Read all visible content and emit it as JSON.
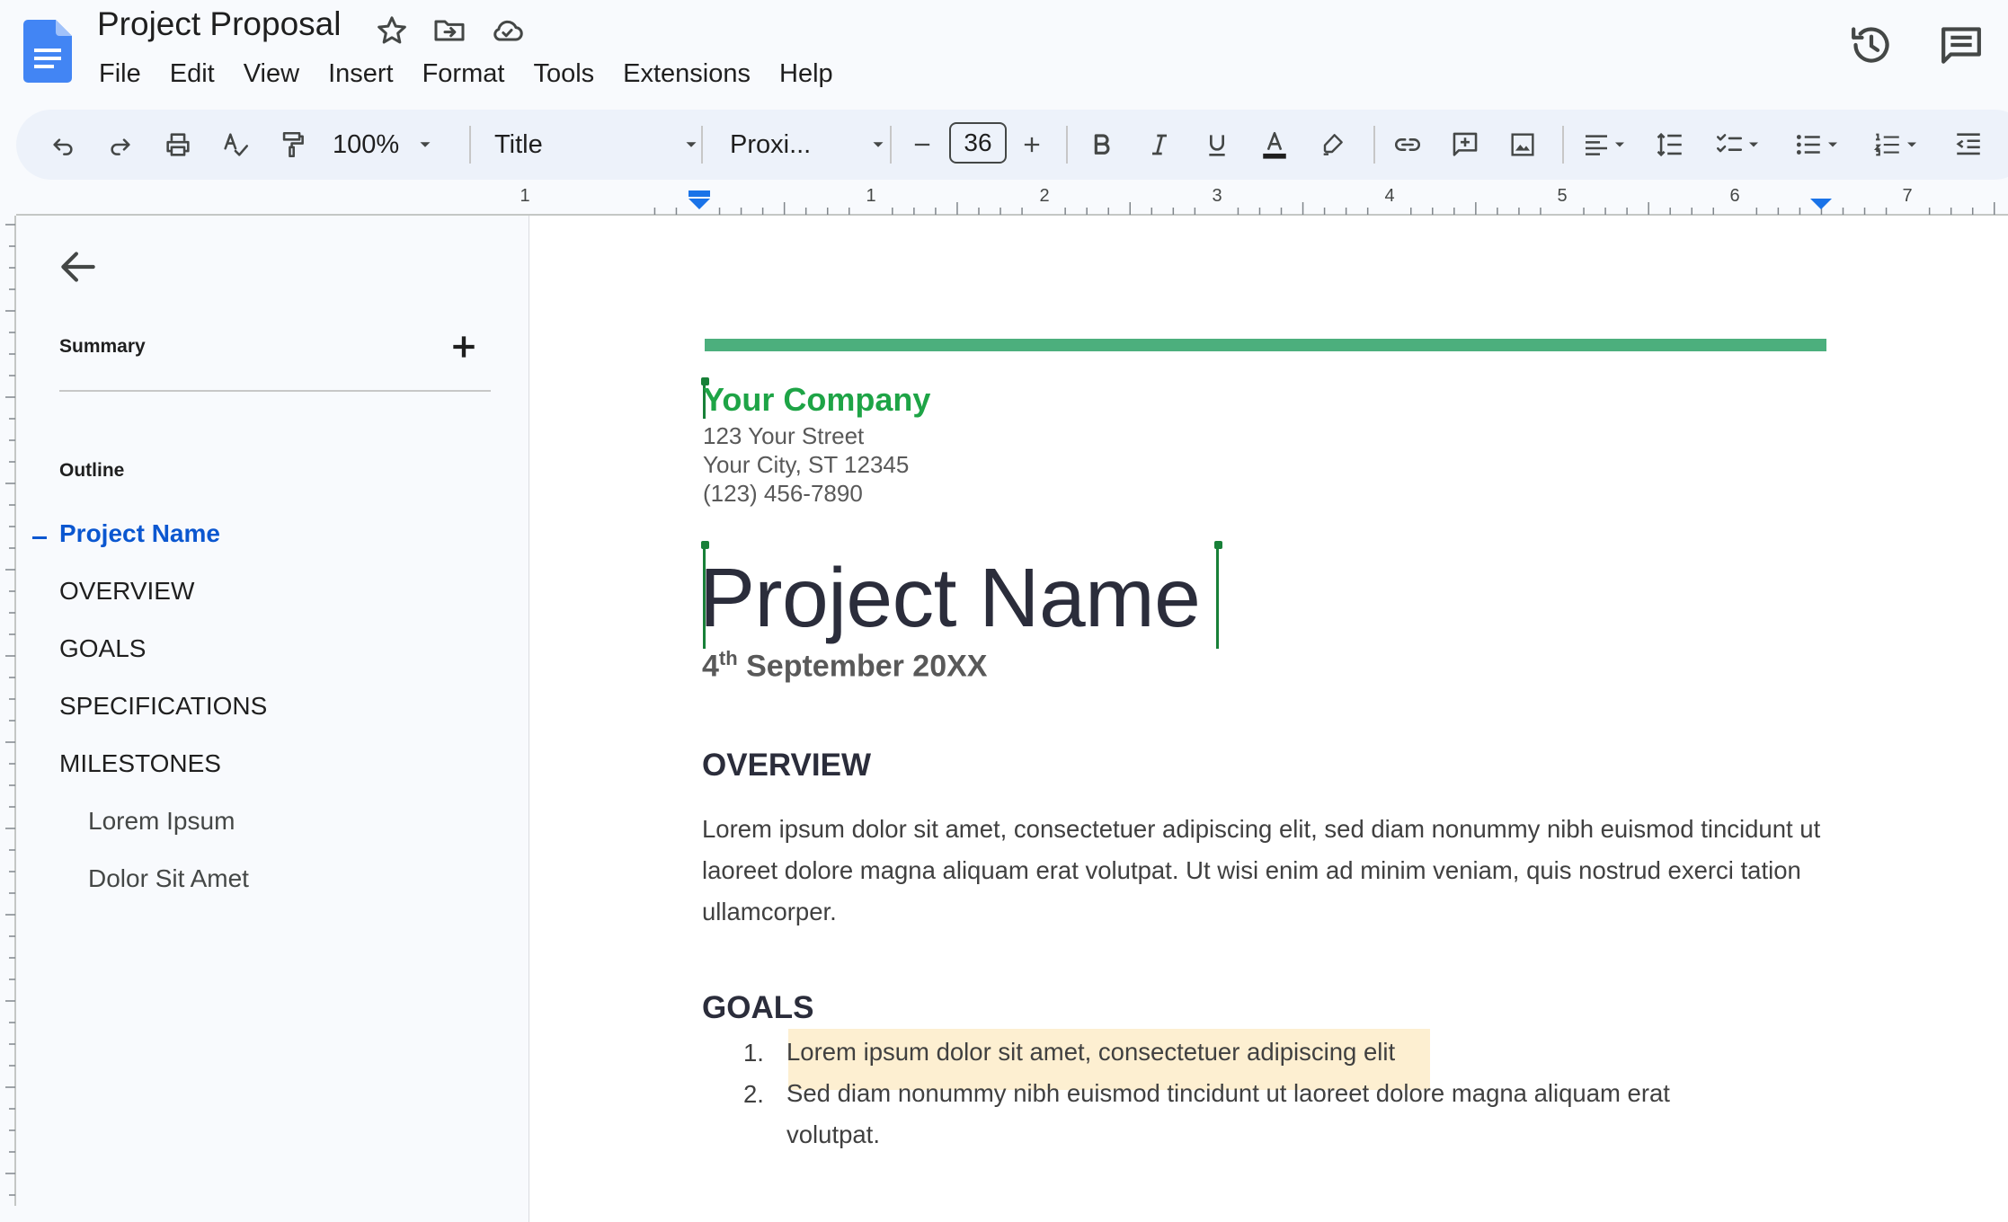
{
  "header": {
    "title": "Project Proposal",
    "menu": [
      "File",
      "Edit",
      "View",
      "Insert",
      "Format",
      "Tools",
      "Extensions",
      "Help"
    ]
  },
  "toolbar": {
    "zoom": "100%",
    "style": "Title",
    "font": "Proxi...",
    "font_size": "36"
  },
  "ruler": {
    "labels": [
      "1",
      "1",
      "2",
      "3",
      "4",
      "5",
      "6",
      "7"
    ]
  },
  "sidebar": {
    "summary_label": "Summary",
    "outline_label": "Outline",
    "outline_items": [
      {
        "label": "Project Name",
        "active": true
      },
      {
        "label": "OVERVIEW"
      },
      {
        "label": "GOALS"
      },
      {
        "label": "SPECIFICATIONS"
      },
      {
        "label": "MILESTONES"
      },
      {
        "label": "Lorem Ipsum"
      },
      {
        "label": "Dolor Sit Amet"
      }
    ]
  },
  "document": {
    "company": "Your Company",
    "address": [
      "123 Your Street",
      "Your City, ST 12345",
      "(123) 456-7890"
    ],
    "title": "Project Name",
    "date_day": "4",
    "date_suffix": "th",
    "date_rest": " September 20XX",
    "overview_heading": "OVERVIEW",
    "overview_body": "Lorem ipsum dolor sit amet, consectetuer adipiscing elit, sed diam nonummy nibh euismod tincidunt ut laoreet dolore magna aliquam erat volutpat. Ut wisi enim ad minim veniam, quis nostrud exerci tation ullamcorper.",
    "goals_heading": "GOALS",
    "goals": [
      {
        "num": "1.",
        "text": "Lorem ipsum dolor sit amet, consectetuer adipiscing elit"
      },
      {
        "num": "2.",
        "text": "Sed diam nonummy nibh euismod tincidunt ut laoreet dolore magna aliquam erat volutpat."
      }
    ]
  },
  "colors": {
    "accent_blue": "#0b57d0",
    "brand_green": "#1ea446",
    "bar_green": "#4caf7d",
    "highlight": "#fdefd1"
  },
  "icons": [
    "docs-logo",
    "star-icon",
    "move-folder-icon",
    "cloud-saved-icon",
    "history-icon",
    "comments-icon"
  ]
}
